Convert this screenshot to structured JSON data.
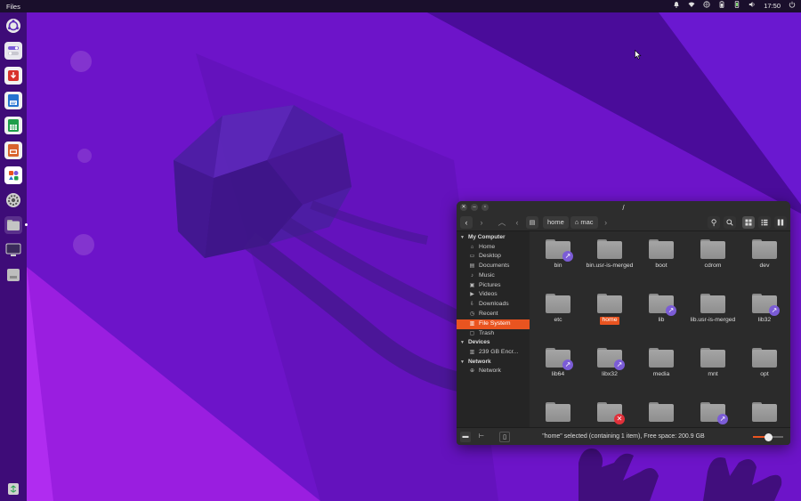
{
  "topbar": {
    "app_name": "Files",
    "clock": "17:50",
    "icons": [
      "bell-icon",
      "wifi-icon",
      "network-icon",
      "battery-icon",
      "phone-icon",
      "volume-icon",
      "power-icon"
    ]
  },
  "dock": {
    "items": [
      {
        "name": "ubuntu-icon",
        "color": "#f0f0f0"
      },
      {
        "name": "settings-toggle-icon",
        "color": "#e0e0e0"
      },
      {
        "name": "software-icon",
        "color": "#d8332d"
      },
      {
        "name": "writer-icon",
        "color": "#2473d0"
      },
      {
        "name": "calc-icon",
        "color": "#1e9e4a"
      },
      {
        "name": "impress-icon",
        "color": "#d8632d"
      },
      {
        "name": "app-center-icon",
        "color": "#ffffff"
      },
      {
        "name": "gear-icon",
        "color": "#cfcfcf"
      },
      {
        "name": "files-icon",
        "color": "#bdbdbd"
      },
      {
        "name": "screen-icon",
        "color": "#3a2a5a"
      },
      {
        "name": "usb-drive-icon",
        "color": "#c0c0c0"
      },
      {
        "name": "trash-icon",
        "color": "#cfcfcf"
      }
    ]
  },
  "window": {
    "title": "/",
    "breadcrumbs": [
      "home",
      "mac"
    ],
    "sidebar": {
      "sections": [
        {
          "title": "My Computer",
          "items": [
            {
              "label": "Home",
              "icon": "home-icon",
              "selected": false
            },
            {
              "label": "Desktop",
              "icon": "desktop-icon",
              "selected": false
            },
            {
              "label": "Documents",
              "icon": "documents-icon",
              "selected": false
            },
            {
              "label": "Music",
              "icon": "music-icon",
              "selected": false
            },
            {
              "label": "Pictures",
              "icon": "pictures-icon",
              "selected": false
            },
            {
              "label": "Videos",
              "icon": "videos-icon",
              "selected": false
            },
            {
              "label": "Downloads",
              "icon": "downloads-icon",
              "selected": false
            },
            {
              "label": "Recent",
              "icon": "recent-icon",
              "selected": false
            },
            {
              "label": "File System",
              "icon": "drive-icon",
              "selected": true
            },
            {
              "label": "Trash",
              "icon": "trash-icon",
              "selected": false
            }
          ]
        },
        {
          "title": "Devices",
          "items": [
            {
              "label": "239 GB Encr...",
              "icon": "drive-icon",
              "selected": false
            }
          ]
        },
        {
          "title": "Network",
          "items": [
            {
              "label": "Network",
              "icon": "network-icon",
              "selected": false
            }
          ]
        }
      ]
    },
    "files": [
      {
        "name": "bin",
        "badge": "link"
      },
      {
        "name": "bin.usr-is-merged",
        "badge": ""
      },
      {
        "name": "boot",
        "badge": ""
      },
      {
        "name": "cdrom",
        "badge": ""
      },
      {
        "name": "dev",
        "badge": ""
      },
      {
        "name": "etc",
        "badge": ""
      },
      {
        "name": "home",
        "badge": "",
        "selected": true
      },
      {
        "name": "lib",
        "badge": "link"
      },
      {
        "name": "lib.usr-is-merged",
        "badge": ""
      },
      {
        "name": "lib32",
        "badge": "link"
      },
      {
        "name": "lib64",
        "badge": "link"
      },
      {
        "name": "libx32",
        "badge": "link"
      },
      {
        "name": "media",
        "badge": ""
      },
      {
        "name": "mnt",
        "badge": ""
      },
      {
        "name": "opt",
        "badge": ""
      },
      {
        "name": "",
        "badge": ""
      },
      {
        "name": "",
        "badge": "noaccess"
      },
      {
        "name": "",
        "badge": ""
      },
      {
        "name": "",
        "badge": "link"
      },
      {
        "name": "",
        "badge": ""
      }
    ],
    "status_text": "\"home\" selected (containing 1 item), Free space: 200.9 GB",
    "zoom_level": 0.5
  },
  "colors": {
    "accent": "#e95420",
    "link_badge": "#7b5cd6"
  }
}
